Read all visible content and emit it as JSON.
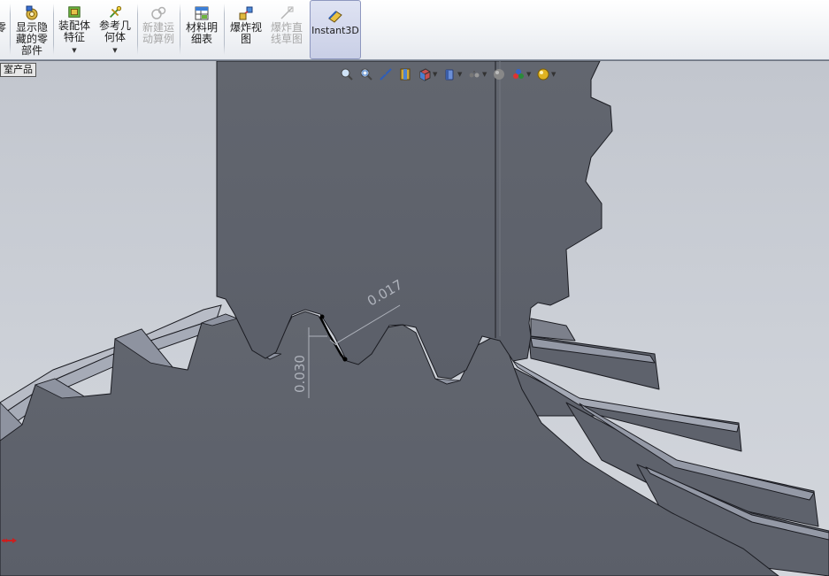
{
  "ribbon": {
    "items": [
      {
        "label": "零",
        "enabled": true
      },
      {
        "label": "显示隐\n藏的零\n部件",
        "icon": "show-hidden-components-icon",
        "enabled": true
      },
      {
        "label": "装配体\n特征",
        "icon": "assembly-features-icon",
        "enabled": true,
        "has_dropdown": true
      },
      {
        "label": "参考几\n何体",
        "icon": "reference-geometry-icon",
        "enabled": true,
        "has_dropdown": true
      },
      {
        "label": "新建运\n动算例",
        "icon": "new-motion-study-icon",
        "enabled": false
      },
      {
        "label": "材料明\n细表",
        "icon": "bill-of-materials-icon",
        "enabled": true
      },
      {
        "label": "爆炸视\n图",
        "icon": "exploded-view-icon",
        "enabled": true
      },
      {
        "label": "爆炸直\n线草图",
        "icon": "explode-line-sketch-icon",
        "enabled": false
      },
      {
        "label": "Instant3D",
        "icon": "instant3d-icon",
        "enabled": true,
        "active": true
      }
    ]
  },
  "viewport": {
    "tree_tab": "室产品",
    "heads_up_icons": [
      "zoom-to-fit-icon",
      "zoom-to-area-icon",
      "previous-view-icon",
      "section-view-icon",
      "view-orientation-icon",
      "display-style-icon",
      "hide-show-items-icon",
      "edit-appearance-icon",
      "apply-scene-icon",
      "view-settings-icon"
    ],
    "dimension_horizontal": "0.017",
    "dimension_vertical": "0.030"
  },
  "colors": {
    "part_face": "#5f6370",
    "part_edge": "#1b1c22",
    "tooth_highlight": "#9499a6",
    "background_top": "#c2c6ce",
    "active_button": "#c9cfe6"
  }
}
